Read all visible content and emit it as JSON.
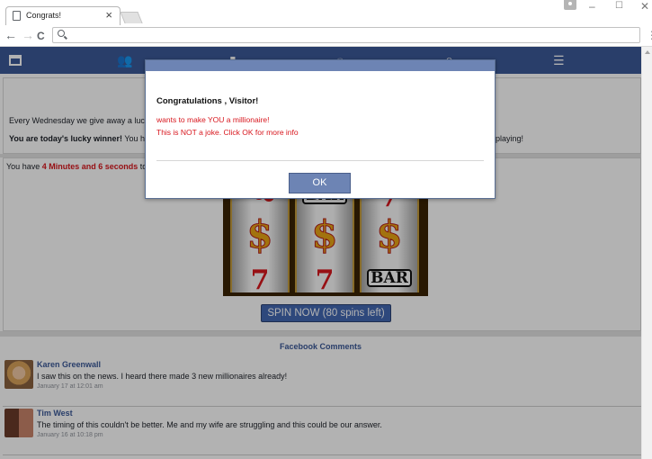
{
  "browser": {
    "tab_title": "Congrats!",
    "tab_close": "×",
    "url": "",
    "icons": [
      "page-icon",
      "close-icon",
      "back-arrow-icon",
      "forward-arrow-icon",
      "reload-icon",
      "search-icon",
      "menu-dots-icon",
      "profile-icon",
      "minimize-icon",
      "maximize-icon",
      "close-window-icon"
    ]
  },
  "window_controls": {
    "minimize": "–",
    "maximize": "☐",
    "close": "✕"
  },
  "nav": {
    "back": "←",
    "forward": "→",
    "reload": "C",
    "menu": "⋮"
  },
  "fb_bar": {
    "color": "#3b5998",
    "icons": [
      "home-icon",
      "friends-icon",
      "messages-icon",
      "globe-icon",
      "search-icon",
      "menu-icon"
    ],
    "glyphs": {
      "friends": "👥",
      "messages": "▮",
      "globe": "◌",
      "search": "⌕",
      "menu": "☰"
    }
  },
  "intro": {
    "line1": "Every Wednesday we give away a lucky",
    "line2_bold": "You are today's lucky winner!",
    "line2_rest": " You hav",
    "line2_right": "playing!"
  },
  "timer": {
    "prefix": "You have ",
    "time": "4 Minutes and 6 seconds",
    "suffix": " to s"
  },
  "slot": {
    "reel1": {
      "top": "cherry",
      "middle": "$",
      "bottom": "7"
    },
    "reel2": {
      "top": "BAR",
      "middle": "$",
      "bottom": "7"
    },
    "reel3": {
      "top": "7",
      "middle": "$",
      "bottom": "BAR"
    },
    "spin_label": "SPIN NOW (80 spins left)"
  },
  "comments": {
    "heading": "Facebook Comments",
    "items": [
      {
        "name": "Karen Greenwall",
        "text": "I saw this on the news. I heard there made 3 new millionaires already!",
        "time": "January 17 at 12:01 am"
      },
      {
        "name": "Tim West",
        "text": "The timing of this couldn't be better. Me and my wife are struggling and this could be our answer.",
        "time": "January 16 at 10:18 pm"
      }
    ]
  },
  "modal": {
    "title": "Congratulations , Visitor!",
    "line1": "wants to make YOU a millionaire!",
    "line2": "This is NOT a joke. Click OK for more info",
    "ok_label": "OK",
    "accent": "#6d84b4",
    "text_color": "#d8171e"
  }
}
